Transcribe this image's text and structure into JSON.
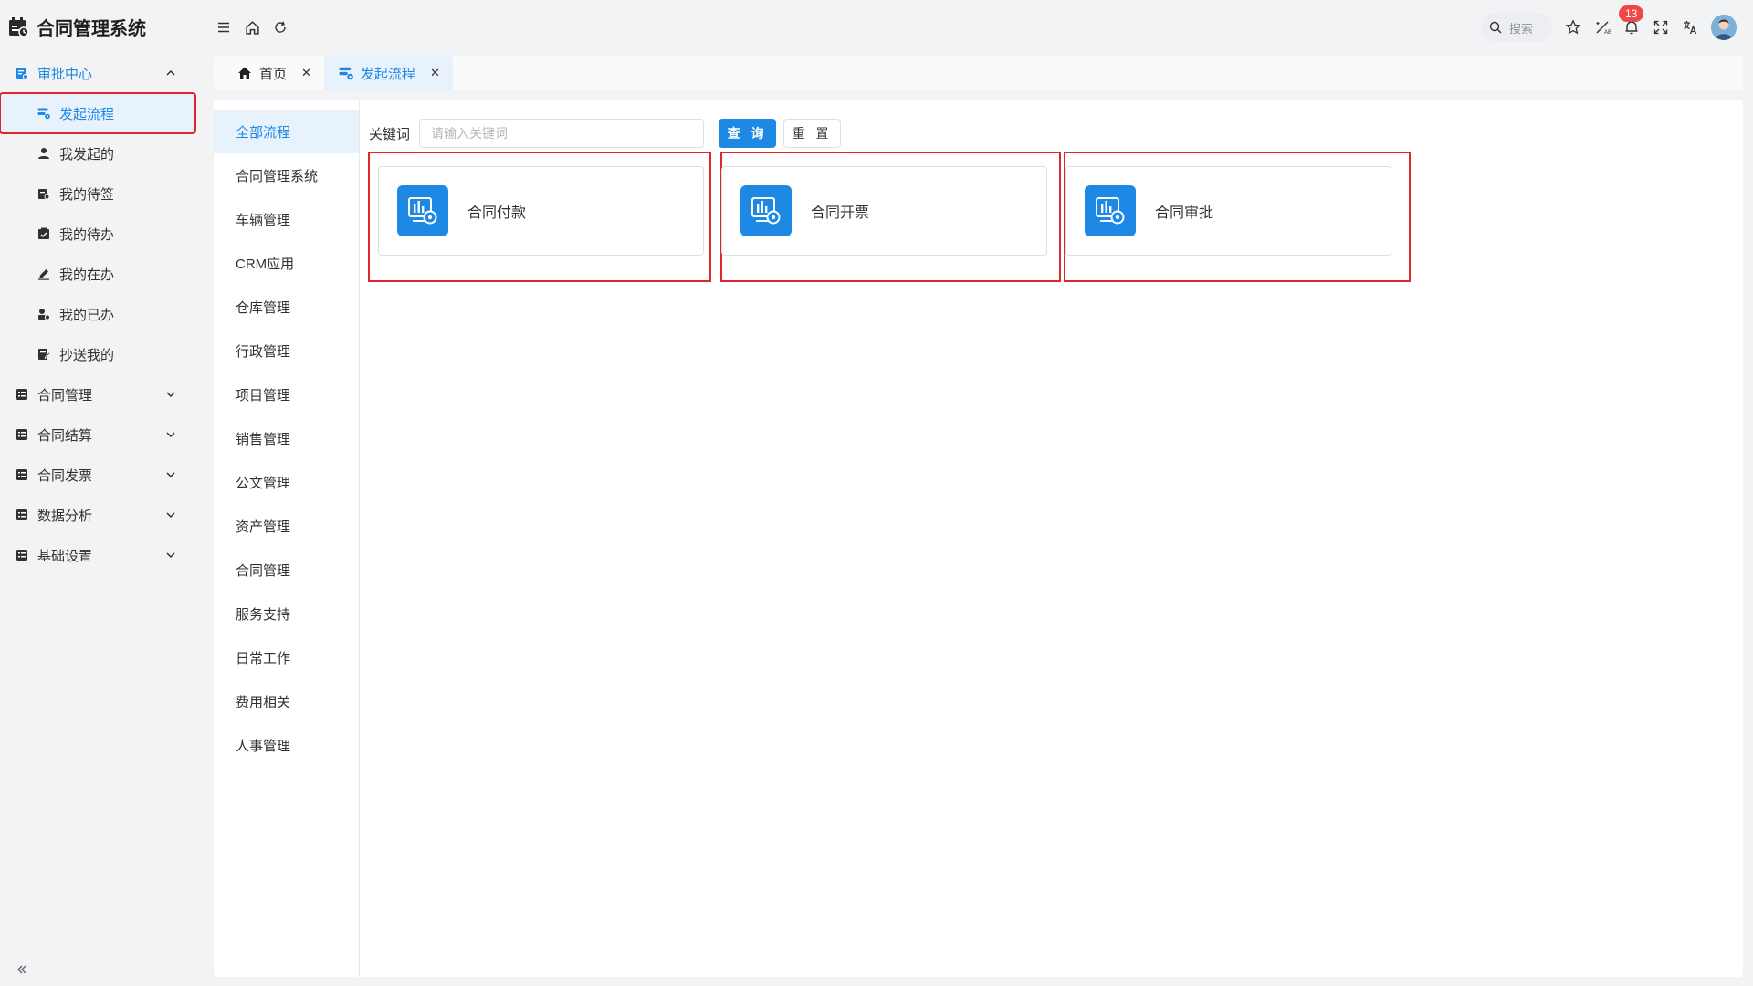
{
  "app": {
    "title": "合同管理系统"
  },
  "sidebar": {
    "groups": [
      {
        "label": "审批中心",
        "expanded": true,
        "icon": "approval-icon",
        "children": [
          {
            "label": "发起流程",
            "icon": "flow-icon",
            "current": true
          },
          {
            "label": "我发起的",
            "icon": "user-icon"
          },
          {
            "label": "我的待签",
            "icon": "sign-icon"
          },
          {
            "label": "我的待办",
            "icon": "todo-icon"
          },
          {
            "label": "我的在办",
            "icon": "edit-icon"
          },
          {
            "label": "我的已办",
            "icon": "done-icon"
          },
          {
            "label": "抄送我的",
            "icon": "cc-icon"
          }
        ]
      },
      {
        "label": "合同管理",
        "expanded": false,
        "icon": "list-icon"
      },
      {
        "label": "合同结算",
        "expanded": false,
        "icon": "list-icon"
      },
      {
        "label": "合同发票",
        "expanded": false,
        "icon": "list-icon"
      },
      {
        "label": "数据分析",
        "expanded": false,
        "icon": "list-icon"
      },
      {
        "label": "基础设置",
        "expanded": false,
        "icon": "list-icon"
      }
    ]
  },
  "header": {
    "search_placeholder": "搜索",
    "notification_count": "13"
  },
  "tabs": [
    {
      "label": "首页",
      "icon": "home-icon",
      "active": false
    },
    {
      "label": "发起流程",
      "icon": "flow-icon",
      "active": true
    }
  ],
  "categories": [
    "全部流程",
    "合同管理系统",
    "车辆管理",
    "CRM应用",
    "仓库管理",
    "行政管理",
    "项目管理",
    "销售管理",
    "公文管理",
    "资产管理",
    "合同管理",
    "服务支持",
    "日常工作",
    "费用相关",
    "人事管理"
  ],
  "active_category": "全部流程",
  "search": {
    "keyword_label": "关键词",
    "placeholder": "请输入关键词",
    "query_button": "查 询",
    "reset_button": "重 置"
  },
  "process_cards": [
    {
      "label": "合同付款",
      "icon": "process-chart-icon"
    },
    {
      "label": "合同开票",
      "icon": "process-chart-icon"
    },
    {
      "label": "合同审批",
      "icon": "process-chart-icon"
    }
  ],
  "colors": {
    "accent": "#1e88e5",
    "highlight_frame": "#e0262b",
    "badge": "#f04848"
  }
}
